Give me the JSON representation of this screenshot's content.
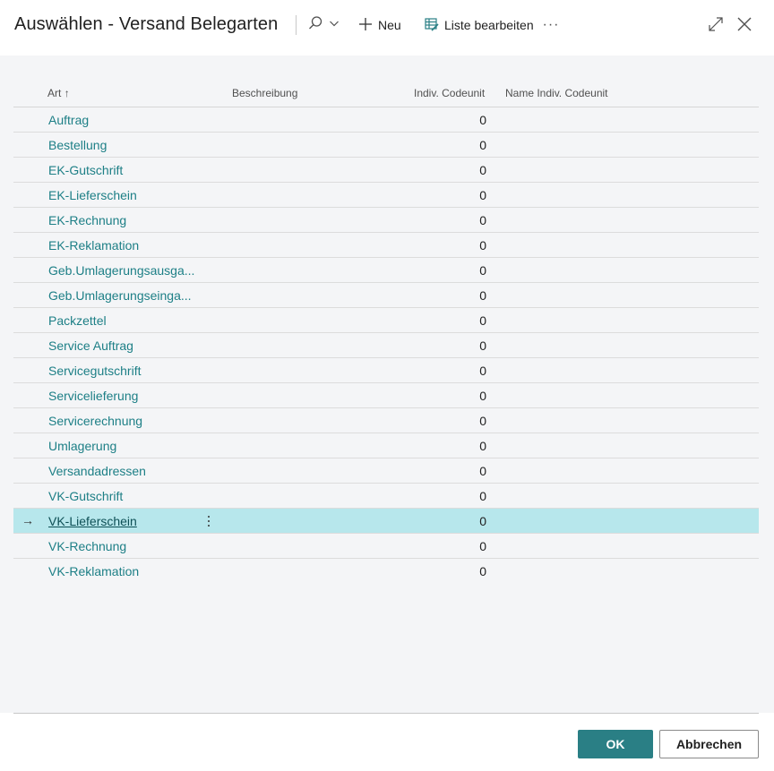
{
  "header": {
    "title": "Auswählen - Versand Belegarten",
    "new_label": "Neu",
    "edit_list_label": "Liste bearbeiten",
    "more_label": "···"
  },
  "table": {
    "columns": {
      "art": "Art",
      "sort_indicator": "↑",
      "beschreibung": "Beschreibung",
      "indiv_codeunit": "Indiv. Codeunit",
      "name_indiv_codeunit": "Name Indiv. Codeunit"
    },
    "rows": [
      {
        "art": "Auftrag",
        "code": "0"
      },
      {
        "art": "Bestellung",
        "code": "0"
      },
      {
        "art": "EK-Gutschrift",
        "code": "0"
      },
      {
        "art": "EK-Lieferschein",
        "code": "0"
      },
      {
        "art": "EK-Rechnung",
        "code": "0"
      },
      {
        "art": "EK-Reklamation",
        "code": "0"
      },
      {
        "art": "Geb.Umlagerungsausga...",
        "code": "0"
      },
      {
        "art": "Geb.Umlagerungseinga...",
        "code": "0"
      },
      {
        "art": "Packzettel",
        "code": "0"
      },
      {
        "art": "Service Auftrag",
        "code": "0"
      },
      {
        "art": "Servicegutschrift",
        "code": "0"
      },
      {
        "art": "Servicelieferung",
        "code": "0"
      },
      {
        "art": "Servicerechnung",
        "code": "0"
      },
      {
        "art": "Umlagerung",
        "code": "0"
      },
      {
        "art": "Versandadressen",
        "code": "0"
      },
      {
        "art": "VK-Gutschrift",
        "code": "0"
      },
      {
        "art": "VK-Lieferschein",
        "code": "0"
      },
      {
        "art": "VK-Rechnung",
        "code": "0"
      },
      {
        "art": "VK-Reklamation",
        "code": "0"
      }
    ],
    "selected_index": 16,
    "selected_arrow": "→"
  },
  "footer": {
    "ok_label": "OK",
    "cancel_label": "Abbrechen"
  },
  "colors": {
    "accent": "#2a7f85",
    "link": "#1d7f86",
    "selected_row": "#b7e7ec",
    "content_bg": "#f4f5f7"
  },
  "icons": {
    "search": "search-icon",
    "dropdown": "chevron-down-icon",
    "new": "plus-icon",
    "edit_list": "edit-list-icon",
    "expand": "expand-icon",
    "close": "close-icon",
    "row_menu": "vertical-ellipsis-icon",
    "row_arrow": "arrow-right-icon"
  }
}
